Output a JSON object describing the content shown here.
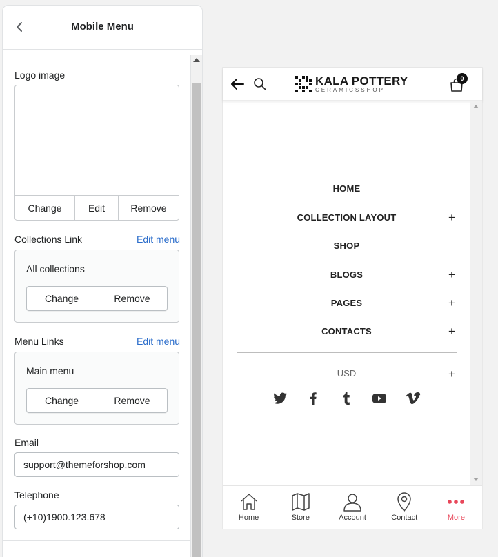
{
  "panel": {
    "title": "Mobile Menu",
    "logo_label": "Logo image",
    "logo_actions": [
      "Change",
      "Edit",
      "Remove"
    ],
    "collections": {
      "label": "Collections Link",
      "edit": "Edit menu",
      "value": "All collections",
      "change": "Change",
      "remove": "Remove"
    },
    "menu_links": {
      "label": "Menu Links",
      "edit": "Edit menu",
      "value": "Main menu",
      "change": "Change",
      "remove": "Remove"
    },
    "email": {
      "label": "Email",
      "value": "support@themeforshop.com"
    },
    "telephone": {
      "label": "Telephone",
      "value": "(+10)1900.123.678"
    }
  },
  "preview": {
    "brand": "KALA POTTERY",
    "brand_sub": "CERAMICSSHOP",
    "cart_count": "0",
    "menu": [
      {
        "label": "HOME",
        "expandable": false
      },
      {
        "label": "COLLECTION LAYOUT",
        "expandable": true
      },
      {
        "label": "SHOP",
        "expandable": false
      },
      {
        "label": "BLOGS",
        "expandable": true
      },
      {
        "label": "PAGES",
        "expandable": true
      },
      {
        "label": "CONTACTS",
        "expandable": true
      }
    ],
    "currency": "USD",
    "plus": "+",
    "socials": [
      "twitter-icon",
      "facebook-icon",
      "tumblr-icon",
      "youtube-icon",
      "vimeo-icon"
    ],
    "bottom_nav": [
      {
        "label": "Home",
        "icon": "home-icon"
      },
      {
        "label": "Store",
        "icon": "map-icon"
      },
      {
        "label": "Account",
        "icon": "user-icon"
      },
      {
        "label": "Contact",
        "icon": "location-pin-icon"
      },
      {
        "label": "More",
        "icon": "more-dots-icon"
      }
    ],
    "accent_color": "#e8475a"
  }
}
